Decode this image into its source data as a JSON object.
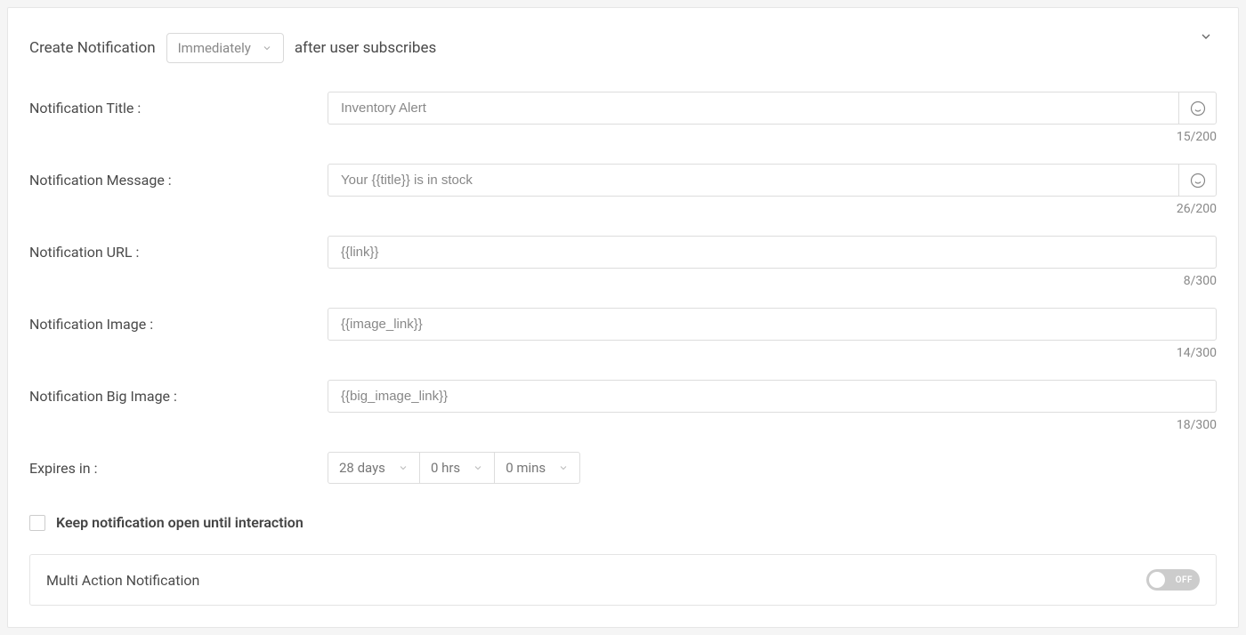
{
  "header": {
    "prefix": "Create Notification",
    "timing_selected": "Immediately",
    "suffix": "after user subscribes"
  },
  "fields": {
    "title": {
      "label": "Notification Title :",
      "value": "Inventory Alert",
      "counter": "15/200"
    },
    "message": {
      "label": "Notification Message :",
      "value": "Your {{title}} is in stock",
      "counter": "26/200"
    },
    "url": {
      "label": "Notification URL :",
      "value": "{{link}}",
      "counter": "8/300"
    },
    "image": {
      "label": "Notification Image :",
      "value": "{{image_link}}",
      "counter": "14/300"
    },
    "big_image": {
      "label": "Notification Big Image :",
      "value": "{{big_image_link}}",
      "counter": "18/300"
    }
  },
  "expires": {
    "label": "Expires in :",
    "days": "28 days",
    "hrs": "0 hrs",
    "mins": "0 mins"
  },
  "keep_open": {
    "label": "Keep notification open until interaction",
    "checked": false
  },
  "multi_action": {
    "label": "Multi Action Notification",
    "state": "OFF"
  }
}
